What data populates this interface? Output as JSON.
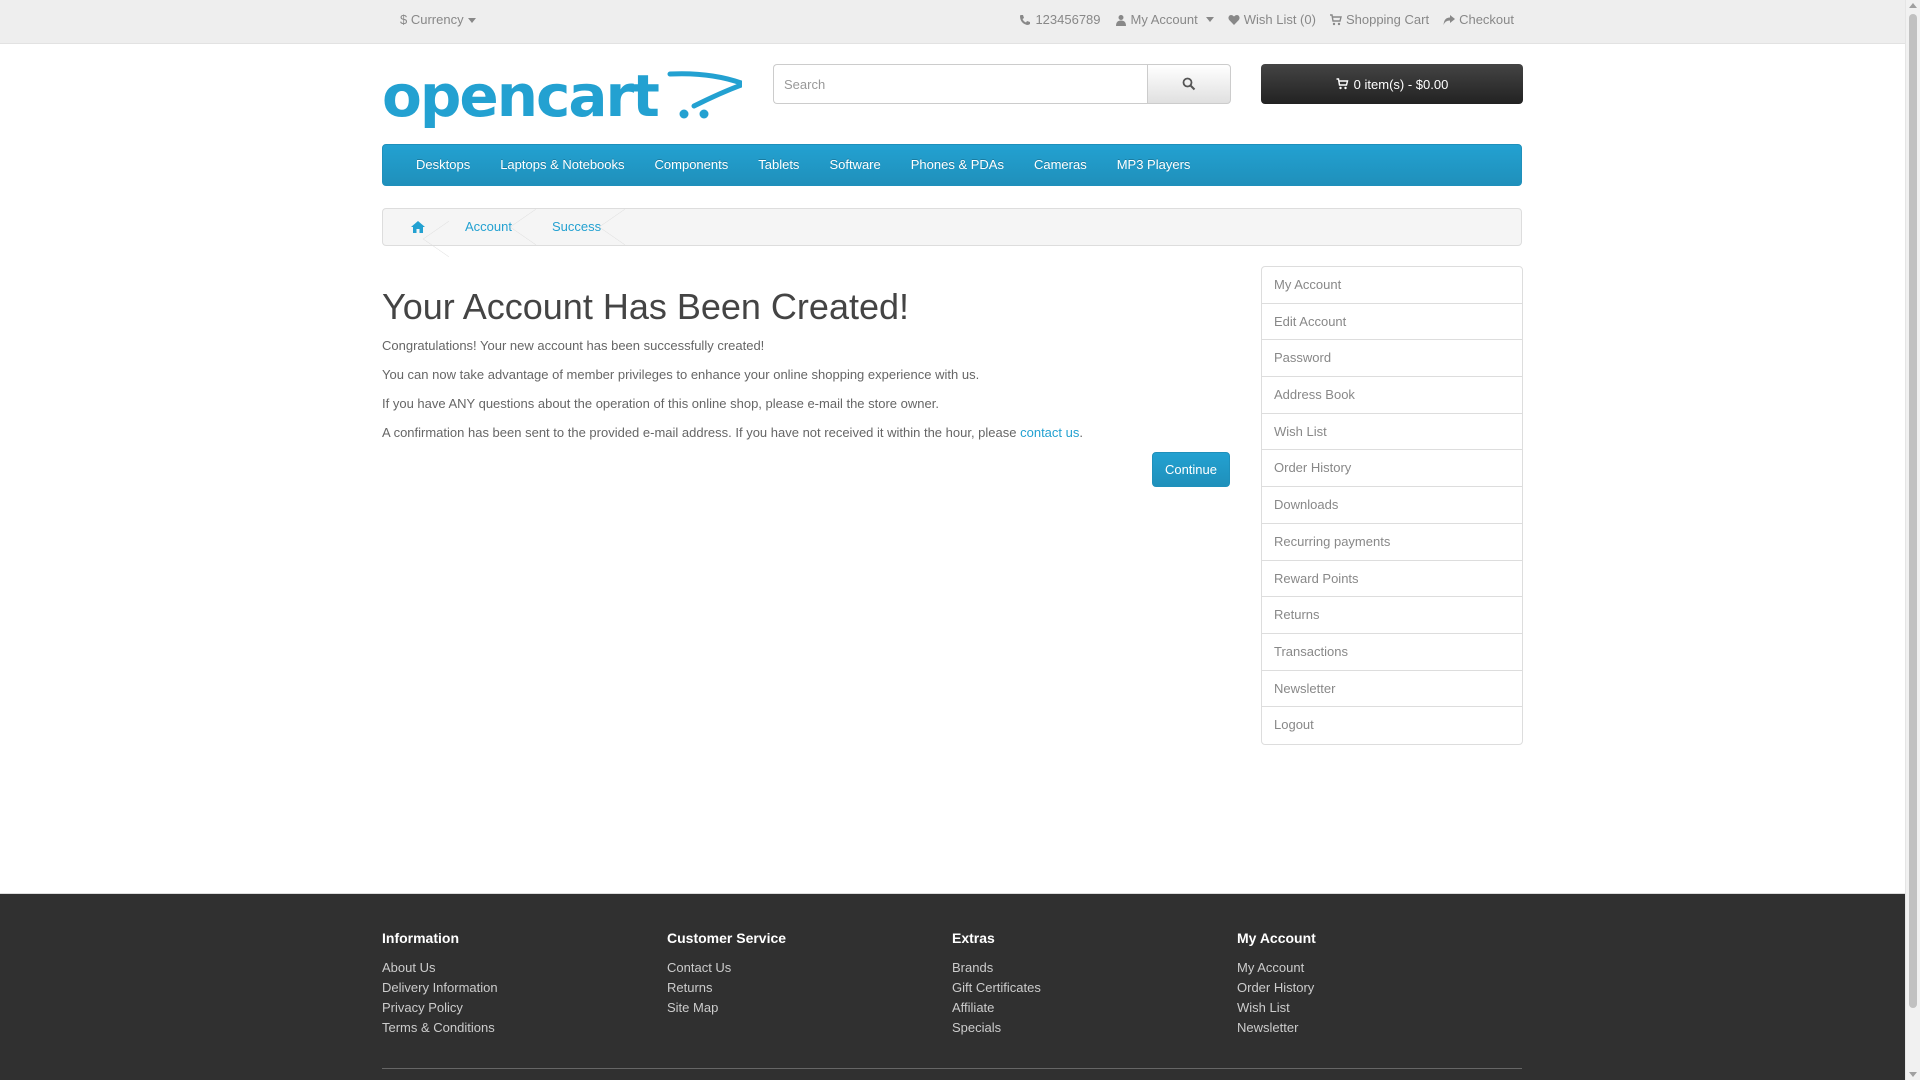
{
  "top": {
    "currency": "$ Currency",
    "phone": "123456789",
    "my_account": "My Account",
    "wish_list": "Wish List (0)",
    "shopping_cart": "Shopping Cart",
    "checkout": "Checkout"
  },
  "header": {
    "logo_text": "opencart",
    "search_placeholder": "Search",
    "cart_label": "0 item(s) - $0.00"
  },
  "menu": [
    "Desktops",
    "Laptops & Notebooks",
    "Components",
    "Tablets",
    "Software",
    "Phones & PDAs",
    "Cameras",
    "MP3 Players"
  ],
  "breadcrumb": {
    "items": [
      "Account",
      "Success"
    ]
  },
  "content": {
    "title": "Your Account Has Been Created!",
    "p1": "Congratulations! Your new account has been successfully created!",
    "p2": "You can now take advantage of member privileges to enhance your online shopping experience with us.",
    "p3": "If you have ANY questions about the operation of this online shop, please e-mail the store owner.",
    "p4_before": "A confirmation has been sent to the provided e-mail address. If you have not received it within the hour, please ",
    "p4_link": "contact us",
    "p4_after": ".",
    "continue": "Continue"
  },
  "sidebar": [
    "My Account",
    "Edit Account",
    "Password",
    "Address Book",
    "Wish List",
    "Order History",
    "Downloads",
    "Recurring payments",
    "Reward Points",
    "Returns",
    "Transactions",
    "Newsletter",
    "Logout"
  ],
  "footer": {
    "information": {
      "title": "Information",
      "links": [
        "About Us",
        "Delivery Information",
        "Privacy Policy",
        "Terms & Conditions"
      ]
    },
    "customer_service": {
      "title": "Customer Service",
      "links": [
        "Contact Us",
        "Returns",
        "Site Map"
      ]
    },
    "extras": {
      "title": "Extras",
      "links": [
        "Brands",
        "Gift Certificates",
        "Affiliate",
        "Specials"
      ]
    },
    "my_account": {
      "title": "My Account",
      "links": [
        "My Account",
        "Order History",
        "Wish List",
        "Newsletter"
      ]
    }
  },
  "colors": {
    "brand_blue": "#23a1d1",
    "footer_bg": "#303030",
    "cart_bg": "#363636"
  }
}
